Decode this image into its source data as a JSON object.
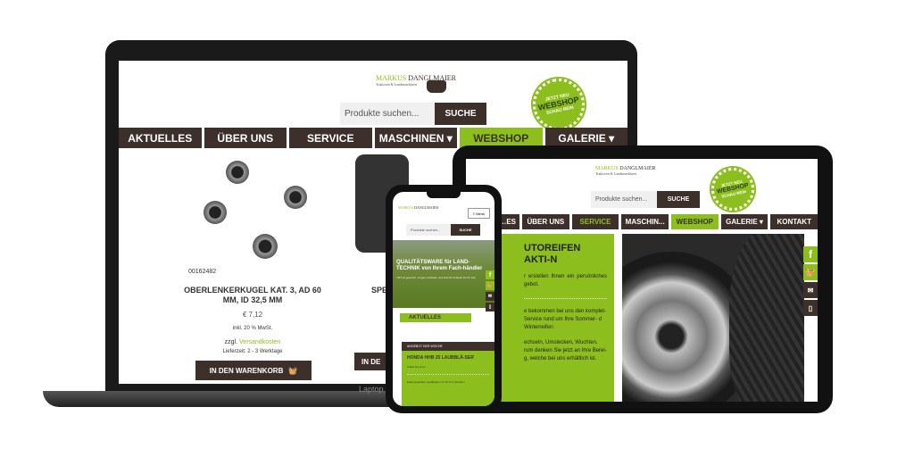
{
  "colors": {
    "brand_green": "#8cbf1e",
    "brand_brown": "#3d302a"
  },
  "logo": {
    "name_part1": "MARKUS",
    "name_part2": "DANGLMAIER",
    "tagline": "Traktoren & Landmaschinen"
  },
  "badge": {
    "top": "JETZT NEU",
    "main": "WEBSHOP",
    "bottom": "SCHAU REIN"
  },
  "search": {
    "placeholder": "Produkte suchen...",
    "button": "SUCHE"
  },
  "laptop": {
    "label": "Laptop",
    "nav": [
      "AKTUELLES",
      "ÜBER UNS",
      "SERVICE",
      "MASCHINEN ▾",
      "WEBSHOP",
      "GALERIE ▾"
    ],
    "product": {
      "sku": "00162482",
      "title": "OBERLENKERKUGEL KAT. 3, AD 60 MM, ID 32,5 MM",
      "price": "€ 7,12",
      "tax": "inkl. 20 % MwSt.",
      "shipping_prefix": "zzgl.",
      "shipping_link": "Versandkosten",
      "delivery": "Lieferzeit: 2 - 3 Werktage",
      "cart_button": "IN DEN WARENKORB"
    },
    "product2": {
      "title_partial": "SPE",
      "cart_partial": "IN DE"
    }
  },
  "tablet": {
    "nav": [
      "…ES",
      "ÜBER UNS",
      "SERVICE",
      "MASCHIN...",
      "WEBSHOP",
      "GALERIE ▾",
      "KONTAKT"
    ],
    "heading": "UTOREIFEN AKTI-N",
    "p1": "r erstellen Ihnen ein persönliches gebot.",
    "p2": "e bekommen bei uns den komplet- Service rund um Ihre Sommer- d Winterreifen:",
    "p3": "echseln, Umstecken, Wuchten. rum denken Sie jetzt an Ihre Berei- g, welche bei uns erhältlich ist."
  },
  "phone": {
    "menu": "≡ Menü",
    "hero": "QUALITÄTSWARE für LAND-TECHNIK von Ihrem Fach-händler",
    "hero_sub": "TMT ist gewohnt, sorgen zufrieden und sind ihr Anbieter für Ihr Ziel",
    "section": "AKTUELLES",
    "offer_label": "ANGEBOT DER WOCHE",
    "offer_title": "HONDA HHB 25 LAUBBLÄ-SER",
    "article": "Artikel Nummer:",
    "bullet": "leistungsstarker Laubbläser mit 25 cm³ Hubraum"
  }
}
